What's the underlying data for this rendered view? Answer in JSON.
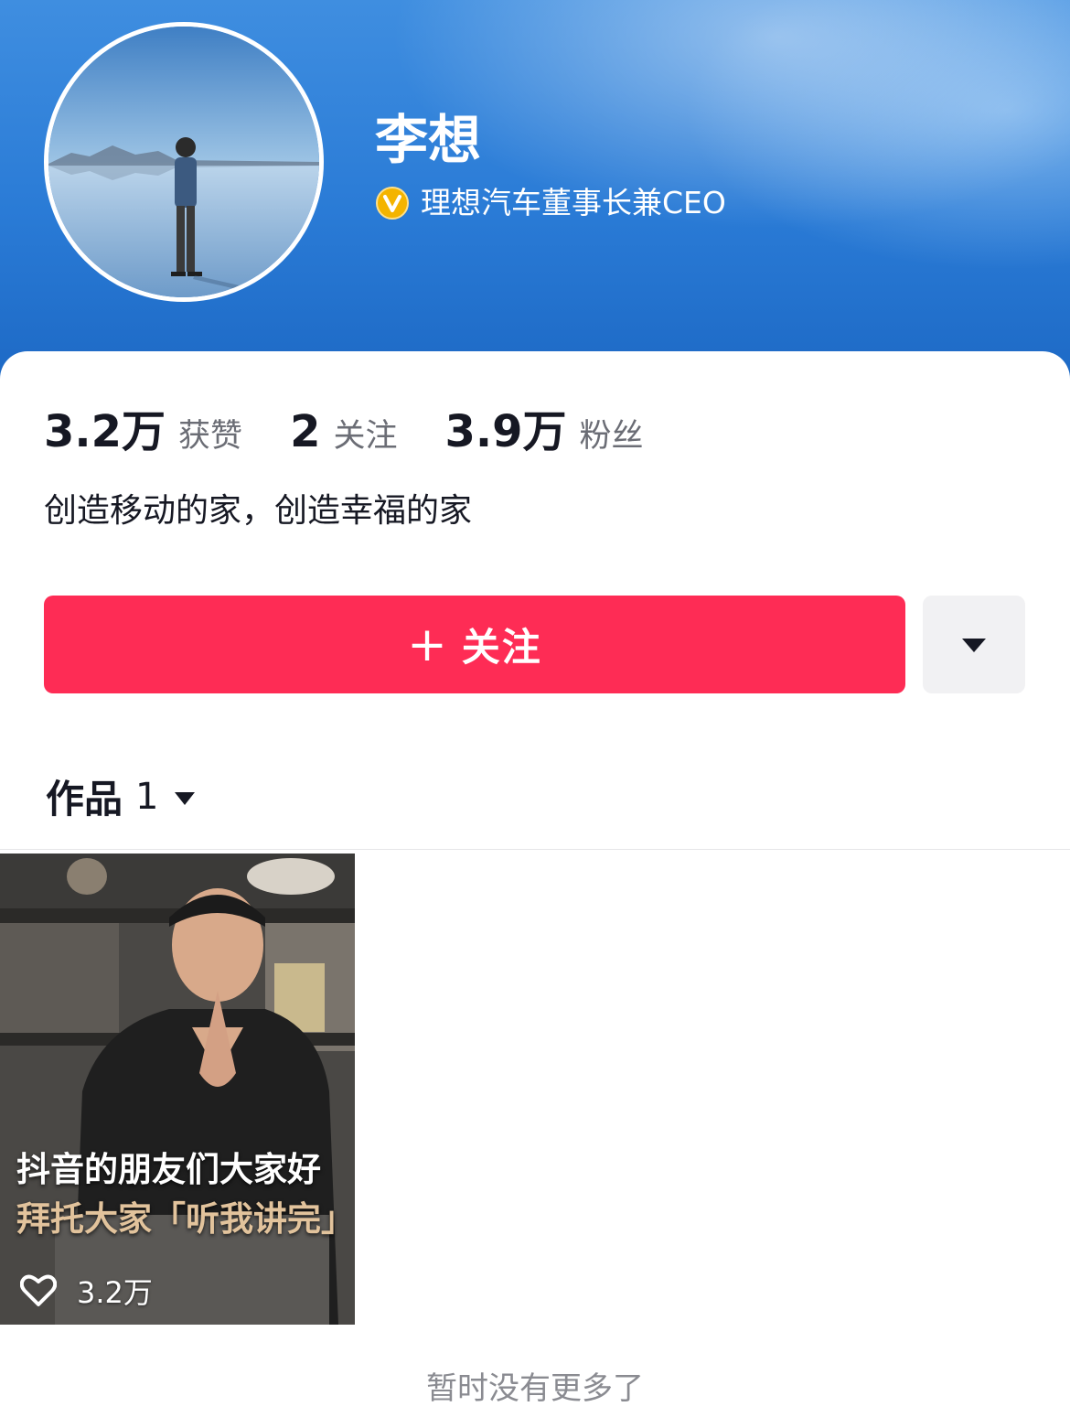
{
  "profile": {
    "name": "李想",
    "verification": "理想汽车董事长兼CEO",
    "verify_icon": "verified-v-badge"
  },
  "stats": [
    {
      "value": "3.2万",
      "label": "获赞"
    },
    {
      "value": "2",
      "label": "关注"
    },
    {
      "value": "3.9万",
      "label": "粉丝"
    }
  ],
  "bio": "创造移动的家，创造幸福的家",
  "actions": {
    "follow_plus": "+",
    "follow_label": "关注",
    "more_icon": "caret-down-icon"
  },
  "works": {
    "label": "作品",
    "count": "1"
  },
  "videos": [
    {
      "caption_line1": "抖音的朋友们大家好",
      "caption_line2": "拜托大家「听我讲完」",
      "likes": "3.2万"
    }
  ],
  "footer": {
    "no_more": "暂时没有更多了"
  },
  "colors": {
    "follow_button": "#fe2c55",
    "header_blue": "#2a7bd6",
    "caption_gold": "#e2c39c"
  }
}
